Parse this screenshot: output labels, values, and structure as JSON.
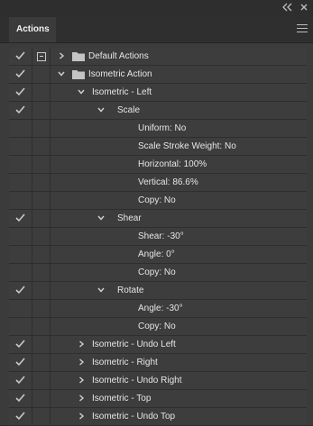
{
  "panel": {
    "tab_label": "Actions"
  },
  "rows": [
    {
      "label": "Default Actions",
      "checked": true,
      "dialog": true,
      "chevron": "right",
      "folder": true,
      "indent": 0
    },
    {
      "label": "Isometric Action",
      "checked": true,
      "dialog": false,
      "chevron": "down",
      "folder": true,
      "indent": 0
    },
    {
      "label": "Isometric - Left",
      "checked": true,
      "dialog": false,
      "chevron": "down",
      "folder": false,
      "indent": 1
    },
    {
      "label": "Scale",
      "checked": true,
      "dialog": false,
      "chevron": "down",
      "folder": false,
      "indent": 2
    },
    {
      "label": "Uniform: No",
      "checked": false,
      "dialog": false,
      "chevron": null,
      "folder": false,
      "indent": 3
    },
    {
      "label": "Scale Stroke Weight: No",
      "checked": false,
      "dialog": false,
      "chevron": null,
      "folder": false,
      "indent": 3
    },
    {
      "label": "Horizontal: 100%",
      "checked": false,
      "dialog": false,
      "chevron": null,
      "folder": false,
      "indent": 3
    },
    {
      "label": "Vertical: 86.6%",
      "checked": false,
      "dialog": false,
      "chevron": null,
      "folder": false,
      "indent": 3
    },
    {
      "label": "Copy: No",
      "checked": false,
      "dialog": false,
      "chevron": null,
      "folder": false,
      "indent": 3
    },
    {
      "label": "Shear",
      "checked": true,
      "dialog": false,
      "chevron": "down",
      "folder": false,
      "indent": 2
    },
    {
      "label": "Shear: -30°",
      "checked": false,
      "dialog": false,
      "chevron": null,
      "folder": false,
      "indent": 3
    },
    {
      "label": "Angle: 0°",
      "checked": false,
      "dialog": false,
      "chevron": null,
      "folder": false,
      "indent": 3
    },
    {
      "label": "Copy: No",
      "checked": false,
      "dialog": false,
      "chevron": null,
      "folder": false,
      "indent": 3
    },
    {
      "label": "Rotate",
      "checked": true,
      "dialog": false,
      "chevron": "down",
      "folder": false,
      "indent": 2
    },
    {
      "label": "Angle: -30°",
      "checked": false,
      "dialog": false,
      "chevron": null,
      "folder": false,
      "indent": 3
    },
    {
      "label": "Copy: No",
      "checked": false,
      "dialog": false,
      "chevron": null,
      "folder": false,
      "indent": 3
    },
    {
      "label": "Isometric - Undo Left",
      "checked": true,
      "dialog": false,
      "chevron": "right",
      "folder": false,
      "indent": 1
    },
    {
      "label": "Isometric - Right",
      "checked": true,
      "dialog": false,
      "chevron": "right",
      "folder": false,
      "indent": 1
    },
    {
      "label": "Isometric - Undo Right",
      "checked": true,
      "dialog": false,
      "chevron": "right",
      "folder": false,
      "indent": 1
    },
    {
      "label": "Isometric - Top",
      "checked": true,
      "dialog": false,
      "chevron": "right",
      "folder": false,
      "indent": 1
    },
    {
      "label": "Isometric - Undo Top",
      "checked": true,
      "dialog": false,
      "chevron": "right",
      "folder": false,
      "indent": 1
    }
  ],
  "colors": {
    "panel_bg": "#3b3b3b",
    "row_bg": "#3d3d3d",
    "text": "#e6e6e6",
    "icon": "#c9c9c9"
  },
  "icons": {
    "collapse_panel": "double-chevron-icon",
    "close_panel": "close-icon",
    "panel_menu": "menu-icon",
    "toggle": "check-icon",
    "dialog": "dialog-toggle-icon",
    "folder": "folder-icon"
  }
}
